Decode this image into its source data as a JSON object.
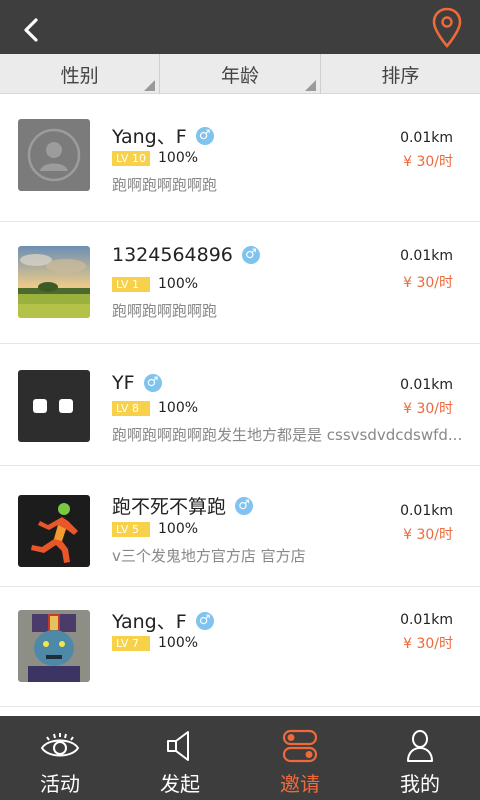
{
  "filters": [
    {
      "label": "性别"
    },
    {
      "label": "年龄"
    },
    {
      "label": "排序"
    }
  ],
  "users": [
    {
      "name": "Yang、F",
      "gender": "♂",
      "level": "LV 10",
      "percent": "100%",
      "desc": "跑啊跑啊跑啊跑",
      "distance": "0.01km",
      "price": "¥ 30/时",
      "avatar": "default-avatar"
    },
    {
      "name": "1324564896",
      "gender": "♂",
      "level": "LV 1",
      "percent": "100%",
      "desc": "跑啊跑啊跑啊跑",
      "distance": "0.01km",
      "price": "¥ 30/时",
      "avatar": "landscape"
    },
    {
      "name": "YF",
      "gender": "♂",
      "level": "LV 8",
      "percent": "100%",
      "desc": "跑啊跑啊跑啊跑发生地方都是是 cssvsdvdcdswfd...",
      "distance": "0.01km",
      "price": "¥ 30/时",
      "avatar": "two-dots"
    },
    {
      "name": "跑不死不算跑",
      "gender": "♂",
      "level": "LV 5",
      "percent": "100%",
      "desc": "v三个发鬼地方官方店 官方店",
      "distance": "0.01km",
      "price": "¥ 30/时",
      "avatar": "runner"
    },
    {
      "name": "Yang、F",
      "gender": "♂",
      "level": "LV 7",
      "percent": "100%",
      "desc": "",
      "distance": "0.01km",
      "price": "¥ 30/时",
      "avatar": "zombie"
    }
  ],
  "tabs": [
    {
      "label": "活动",
      "icon": "eye-icon"
    },
    {
      "label": "发起",
      "icon": "speaker-icon"
    },
    {
      "label": "邀请",
      "icon": "toggle-icon",
      "active": true
    },
    {
      "label": "我的",
      "icon": "person-icon"
    }
  ],
  "colors": {
    "accent": "#ef6a3b",
    "level_badge": "#f7d14a",
    "gender_badge": "#7fc3ee",
    "bar": "#3e3e3e"
  }
}
